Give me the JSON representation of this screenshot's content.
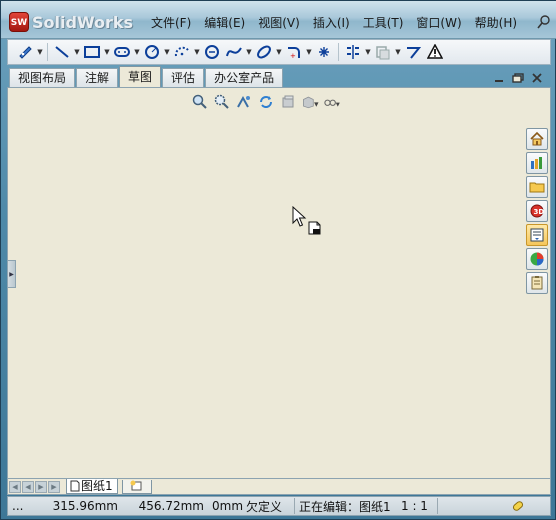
{
  "app": {
    "title": "SolidWorks",
    "logo_badge": "SW"
  },
  "menu": [
    {
      "label": "文件(F)"
    },
    {
      "label": "编辑(E)"
    },
    {
      "label": "视图(V)"
    },
    {
      "label": "插入(I)"
    },
    {
      "label": "工具(T)"
    },
    {
      "label": "窗口(W)"
    },
    {
      "label": "帮助(H)"
    }
  ],
  "toolbar": {
    "tools": [
      "smart-dimension-icon",
      "line-icon",
      "rectangle-icon",
      "slot-icon",
      "circle-icon",
      "arc-icon",
      "polygon-icon",
      "spline-icon",
      "ellipse-icon",
      "fillet-icon",
      "point-icon",
      "mirror-icon",
      "offset-icon",
      "trim-icon",
      "warning-icon"
    ]
  },
  "tabs": [
    {
      "label": "视图布局",
      "active": false
    },
    {
      "label": "注解",
      "active": false
    },
    {
      "label": "草图",
      "active": true
    },
    {
      "label": "评估",
      "active": false
    },
    {
      "label": "办公室产品",
      "active": false
    }
  ],
  "sheet": {
    "tab_label": "图纸1"
  },
  "status": {
    "prefix": "...",
    "x": "315.96mm",
    "y": "456.72mm",
    "z": "0mm",
    "state": "欠定义",
    "editing": "正在编辑：图纸1",
    "scale": "1 : 1"
  },
  "colors": {
    "canvas": "#ece9d8",
    "frame": "#4f8aa9",
    "accent_red": "#c8291e"
  }
}
